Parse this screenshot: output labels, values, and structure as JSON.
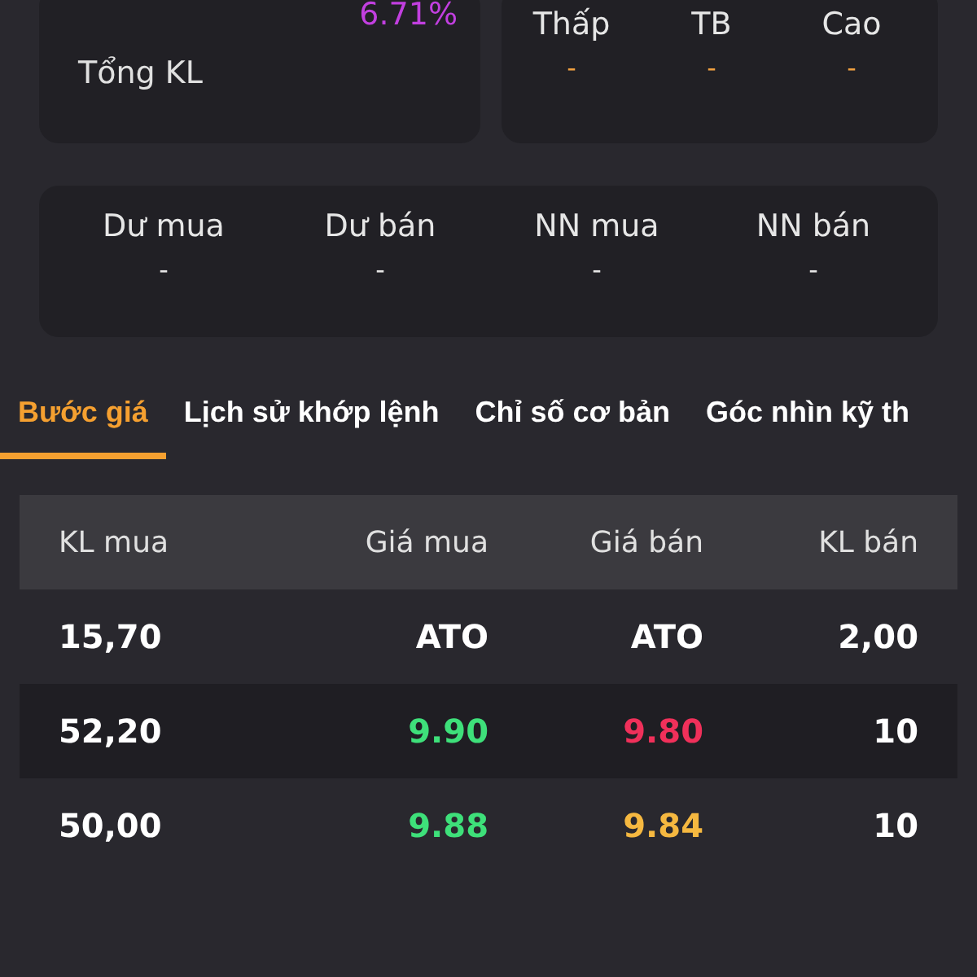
{
  "summary": {
    "change_percent": "6.71%",
    "total_volume_label": "Tổng KL"
  },
  "price_range": [
    {
      "label": "Thấp",
      "value": "-"
    },
    {
      "label": "TB",
      "value": "-"
    },
    {
      "label": "Cao",
      "value": "-"
    }
  ],
  "stats": [
    {
      "label": "Dư mua",
      "value": "-"
    },
    {
      "label": "Dư bán",
      "value": "-"
    },
    {
      "label": "NN mua",
      "value": "-"
    },
    {
      "label": "NN bán",
      "value": "-"
    }
  ],
  "tabs": [
    {
      "label": "Bước giá",
      "selected": true
    },
    {
      "label": "Lịch sử khớp lệnh",
      "selected": false
    },
    {
      "label": "Chỉ số cơ bản",
      "selected": false
    },
    {
      "label": "Góc nhìn kỹ th",
      "selected": false
    }
  ],
  "table": {
    "columns": [
      "KL mua",
      "Giá mua",
      "Giá bán",
      "KL bán"
    ],
    "rows": [
      {
        "buy_volume": "15,70",
        "buy_price": {
          "text": "ATO",
          "color": "#ffffff"
        },
        "sell_price": {
          "text": "ATO",
          "color": "#ffffff"
        },
        "sell_volume": "2,00"
      },
      {
        "buy_volume": "52,20",
        "buy_price": {
          "text": "9.90",
          "color": "#3ee07a"
        },
        "sell_price": {
          "text": "9.80",
          "color": "#f0305a"
        },
        "sell_volume": "10"
      },
      {
        "buy_volume": "50,00",
        "buy_price": {
          "text": "9.88",
          "color": "#3ee07a"
        },
        "sell_price": {
          "text": "9.84",
          "color": "#f5b840"
        },
        "sell_volume": "10"
      }
    ]
  }
}
